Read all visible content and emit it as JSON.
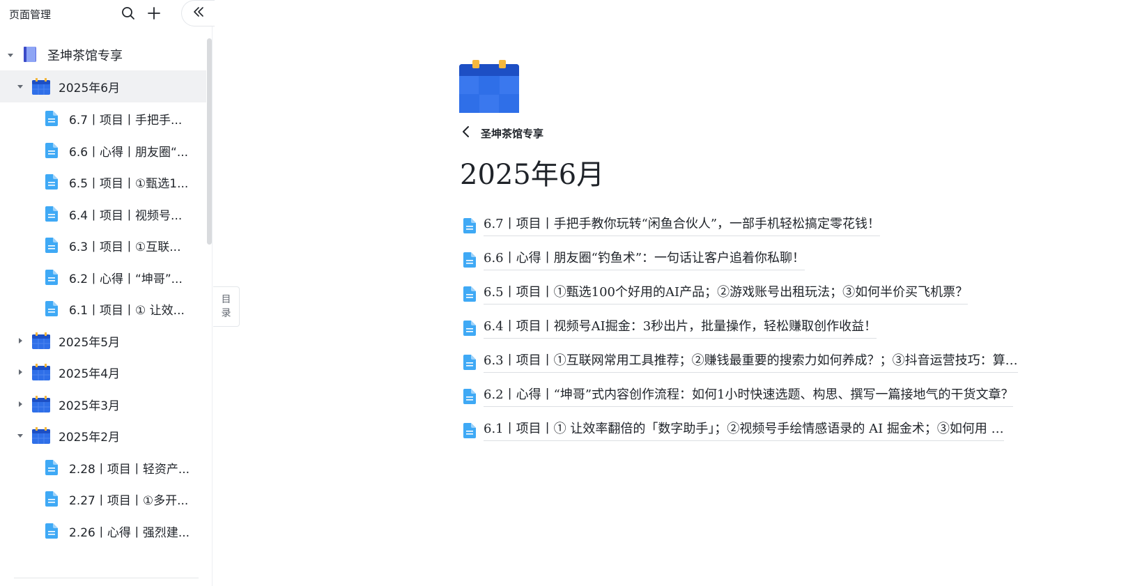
{
  "sidebar": {
    "title": "页面管理",
    "search_icon": "search-icon",
    "add_icon": "plus-icon",
    "collapse_icon": "double-chevron-left-icon",
    "root": {
      "label": "圣坤茶馆专享",
      "icon": "book-icon",
      "expanded": true
    },
    "items": [
      {
        "label": "2025年6月",
        "type": "folder",
        "expanded": true,
        "selected": true,
        "children": [
          {
            "label": "6.7丨项目丨手把手..."
          },
          {
            "label": "6.6丨心得丨朋友圈“..."
          },
          {
            "label": "6.5丨项目丨①甄选1..."
          },
          {
            "label": "6.4丨项目丨视频号..."
          },
          {
            "label": "6.3丨项目丨①互联..."
          },
          {
            "label": "6.2丨心得丨“坤哥”..."
          },
          {
            "label": "6.1丨项目丨① 让效..."
          }
        ]
      },
      {
        "label": "2025年5月",
        "type": "folder",
        "expanded": false
      },
      {
        "label": "2025年4月",
        "type": "folder",
        "expanded": false
      },
      {
        "label": "2025年3月",
        "type": "folder",
        "expanded": false
      },
      {
        "label": "2025年2月",
        "type": "folder",
        "expanded": true,
        "children": [
          {
            "label": "2.28丨项目丨轻资产..."
          },
          {
            "label": "2.27丨项目丨①多开..."
          },
          {
            "label": "2.26丨心得丨强烈建..."
          }
        ]
      }
    ]
  },
  "toc": {
    "label_line1": "目",
    "label_line2": "录"
  },
  "main": {
    "page_icon": "calendar-icon",
    "breadcrumb": {
      "label": "圣坤茶馆专享",
      "icon": "chevron-left-icon"
    },
    "title": "2025年6月",
    "documents": [
      "6.7丨项目丨手把手教你玩转“闲鱼合伙人”，一部手机轻松搞定零花钱！",
      "6.6丨心得丨朋友圈“钓鱼术”：一句话让客户追着你私聊！",
      "6.5丨项目丨①甄选100个好用的AI产品；②游戏账号出租玩法；③如何半价买飞机票？",
      "6.4丨项目丨视频号AI掘金：3秒出片，批量操作，轻松赚取创作收益！",
      "6.3丨项目丨①互联网常用工具推荐；②赚钱最重要的搜索力如何养成？；③抖音运营技巧：算…",
      "6.2丨心得丨“坤哥”式内容创作流程：如何1小时快速选题、构思、撰写一篇接地气的干货文章？",
      "6.1丨项目丨① 让效率翻倍的「数字助手」；②视频号手绘情感语录的 AI 掘金术；③如何用 …"
    ]
  },
  "colors": {
    "accent": "#3370ff",
    "doc_icon": "#3fa9f5",
    "calendar_blue": "#2f6fe8",
    "calendar_tab": "#f5b83d",
    "selected_bg": "#f0f1f3"
  }
}
